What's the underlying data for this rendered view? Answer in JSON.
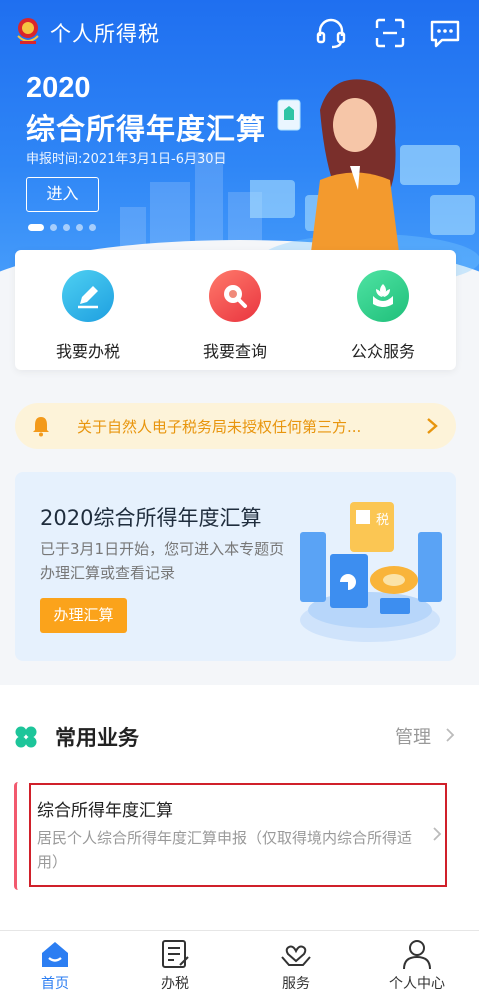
{
  "header": {
    "app_title": "个人所得税",
    "icons": [
      "headset-icon",
      "scan-icon",
      "message-icon"
    ]
  },
  "hero": {
    "year": "2020",
    "title": "综合所得年度汇算",
    "date": "申报时间:2021年3月1日-6月30日",
    "enter_label": "进入",
    "carousel_count": 5,
    "carousel_active": 1
  },
  "quick_actions": [
    {
      "label": "我要办税",
      "icon": "edit-icon",
      "color": "#2bb3e8"
    },
    {
      "label": "我要查询",
      "icon": "search-icon",
      "color": "#f04f4f"
    },
    {
      "label": "公众服务",
      "icon": "service-icon",
      "color": "#2ecf8c"
    }
  ],
  "notice": {
    "text": "关于自然人电子税务局未授权任何第三方..."
  },
  "banner": {
    "title": "2020综合所得年度汇算",
    "desc": "已于3月1日开始，您可进入本专题页办理汇算或查看记录",
    "button_label": "办理汇算"
  },
  "common": {
    "title": "常用业务",
    "manage_label": "管理",
    "items": [
      {
        "title": "综合所得年度汇算",
        "desc": "居民个人综合所得年度汇算申报（仅取得境内综合所得适用）"
      }
    ]
  },
  "tabbar": {
    "items": [
      {
        "label": "首页",
        "icon": "home-icon",
        "active": true
      },
      {
        "label": "办税",
        "icon": "tax-form-icon",
        "active": false
      },
      {
        "label": "服务",
        "icon": "heart-hands-icon",
        "active": false
      },
      {
        "label": "个人中心",
        "icon": "person-icon",
        "active": false
      }
    ]
  },
  "colors": {
    "primary": "#2c7ef2",
    "notice_text": "#e8950d",
    "button_orange": "#fba31b",
    "highlight_box": "#d0202a"
  }
}
